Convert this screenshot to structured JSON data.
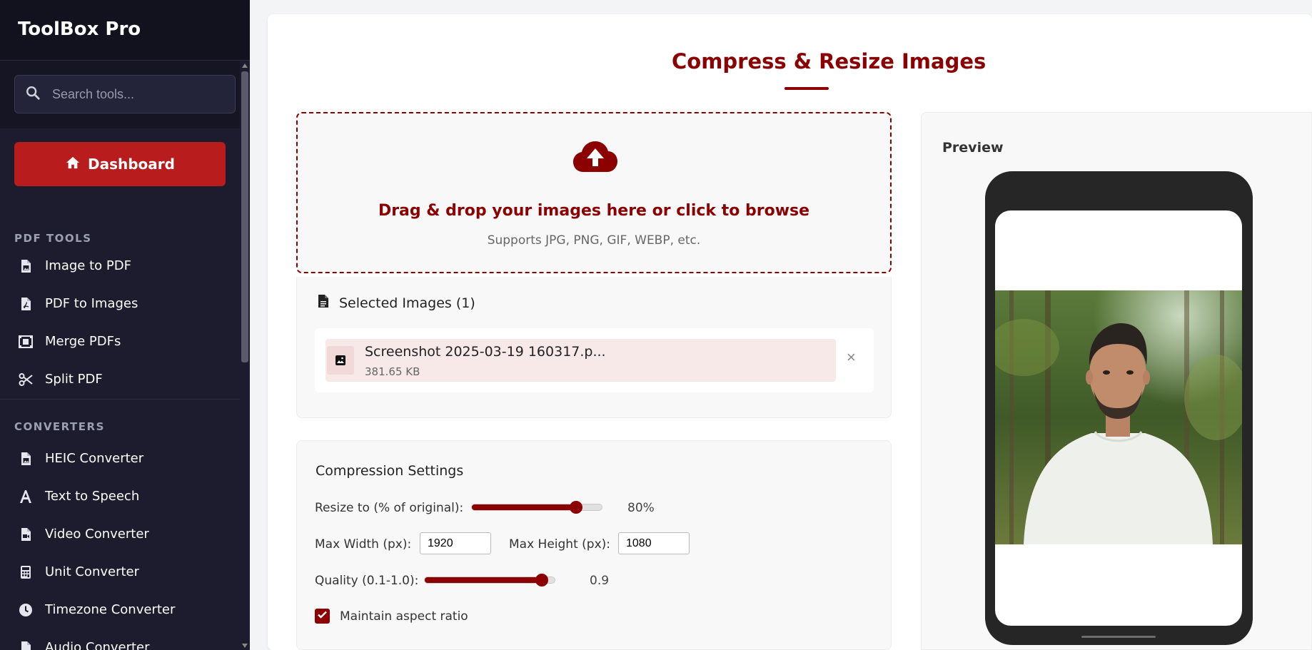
{
  "app": {
    "title": "ToolBox Pro"
  },
  "search": {
    "placeholder": "Search tools..."
  },
  "sidebar": {
    "dashboard_label": "Dashboard",
    "sections": [
      {
        "title": "PDF TOOLS",
        "items": [
          "Image to PDF",
          "PDF to Images",
          "Merge PDFs",
          "Split PDF"
        ]
      },
      {
        "title": "CONVERTERS",
        "items": [
          "HEIC Converter",
          "Text to Speech",
          "Video Converter",
          "Unit Converter",
          "Timezone Converter",
          "Audio Converter"
        ]
      }
    ]
  },
  "page": {
    "title": "Compress & Resize Images"
  },
  "dropzone": {
    "title": "Drag & drop your images here or click to browse",
    "subtitle": "Supports JPG, PNG, GIF, WEBP, etc."
  },
  "selected": {
    "heading": "Selected Images (1)",
    "files": [
      {
        "name": "Screenshot 2025-03-19 160317.p...",
        "size": "381.65 KB"
      }
    ],
    "remove_symbol": "×"
  },
  "settings": {
    "title": "Compression Settings",
    "resize_label": "Resize to (% of original):",
    "resize_value": "80%",
    "resize_level": 0.8,
    "max_width_label": "Max Width (px):",
    "max_width": "1920",
    "max_height_label": "Max Height (px):",
    "max_height": "1080",
    "quality_label": "Quality (0.1-1.0):",
    "quality_value": "0.9",
    "quality_level": 0.9,
    "aspect_label": "Maintain aspect ratio",
    "aspect_checked": true
  },
  "preview": {
    "title": "Preview"
  },
  "colors": {
    "accent": "#8b0000",
    "dashboard": "#b91c1c",
    "sidebar": "#1c1c2e"
  }
}
